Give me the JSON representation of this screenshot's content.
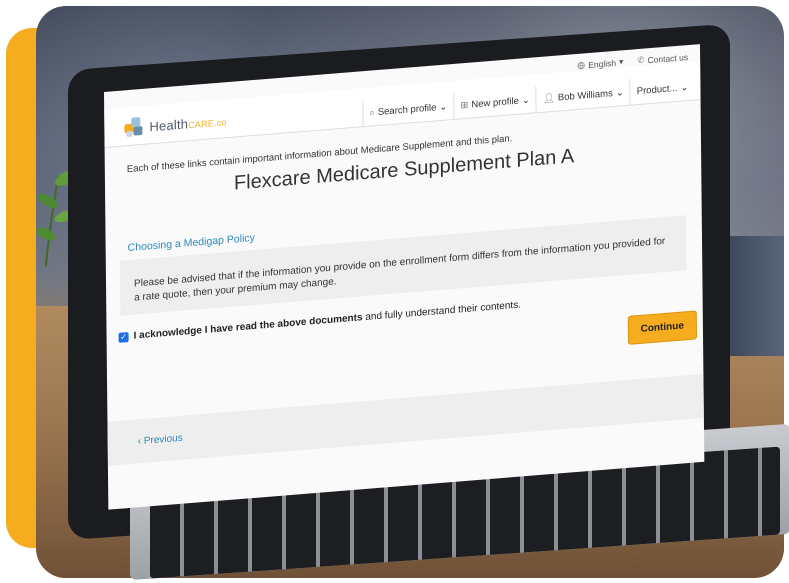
{
  "utility": {
    "language": "English",
    "contact": "Contact us"
  },
  "brand": {
    "name": "Health",
    "suffix": "CARE.co"
  },
  "nav": {
    "search": "Search profile",
    "new_profile": "New profile",
    "user": "Bob Williams",
    "products": "Product..."
  },
  "page": {
    "intro": "Each of these links contain important information about Medicare Supplement and this plan.",
    "title": "Flexcare Medicare Supplement Plan A",
    "doc_link": "Choosing a Medigap Policy",
    "notice": "Please be advised that if the information you provide on the enrollment form differs from the information you provided for a rate quote, then your premium may change.",
    "ack_bold": "I acknowledge I have read the above documents",
    "ack_rest": " and fully understand their contents.",
    "continue": "Continue",
    "previous": "Previous"
  },
  "colors": {
    "accent": "#f5ac1f",
    "link": "#2a8ab6",
    "checkbox": "#1f6fe5",
    "logo_blocks": [
      "#f5ac1f",
      "#9bc1dd",
      "#6b8fa8",
      "#c8d7e3"
    ]
  },
  "icons": {
    "language": "globe-icon",
    "contact": "phone-icon",
    "search": "search-icon",
    "new_profile": "add-document-icon",
    "user": "user-icon",
    "dropdown": "chevron-down-icon",
    "previous": "chevron-left-icon"
  }
}
